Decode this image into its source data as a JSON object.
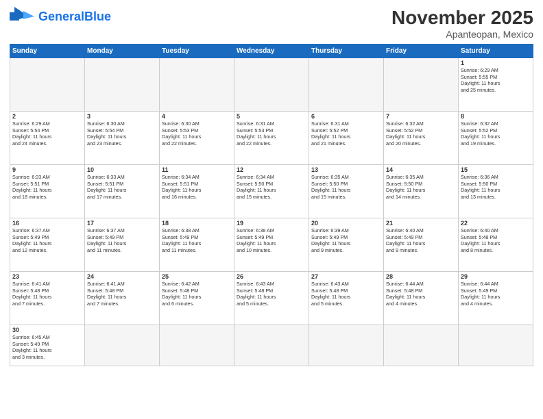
{
  "header": {
    "logo_general": "General",
    "logo_blue": "Blue",
    "title": "November 2025",
    "subtitle": "Apanteopan, Mexico"
  },
  "days_of_week": [
    "Sunday",
    "Monday",
    "Tuesday",
    "Wednesday",
    "Thursday",
    "Friday",
    "Saturday"
  ],
  "weeks": [
    {
      "days": [
        {
          "num": "",
          "info": ""
        },
        {
          "num": "",
          "info": ""
        },
        {
          "num": "",
          "info": ""
        },
        {
          "num": "",
          "info": ""
        },
        {
          "num": "",
          "info": ""
        },
        {
          "num": "",
          "info": ""
        },
        {
          "num": "1",
          "info": "Sunrise: 6:29 AM\nSunset: 5:55 PM\nDaylight: 11 hours\nand 25 minutes."
        }
      ]
    },
    {
      "days": [
        {
          "num": "2",
          "info": "Sunrise: 6:29 AM\nSunset: 5:54 PM\nDaylight: 11 hours\nand 24 minutes."
        },
        {
          "num": "3",
          "info": "Sunrise: 6:30 AM\nSunset: 5:54 PM\nDaylight: 11 hours\nand 23 minutes."
        },
        {
          "num": "4",
          "info": "Sunrise: 6:30 AM\nSunset: 5:53 PM\nDaylight: 11 hours\nand 22 minutes."
        },
        {
          "num": "5",
          "info": "Sunrise: 6:31 AM\nSunset: 5:53 PM\nDaylight: 11 hours\nand 22 minutes."
        },
        {
          "num": "6",
          "info": "Sunrise: 6:31 AM\nSunset: 5:52 PM\nDaylight: 11 hours\nand 21 minutes."
        },
        {
          "num": "7",
          "info": "Sunrise: 6:32 AM\nSunset: 5:52 PM\nDaylight: 11 hours\nand 20 minutes."
        },
        {
          "num": "8",
          "info": "Sunrise: 6:32 AM\nSunset: 5:52 PM\nDaylight: 11 hours\nand 19 minutes."
        }
      ]
    },
    {
      "days": [
        {
          "num": "9",
          "info": "Sunrise: 6:33 AM\nSunset: 5:51 PM\nDaylight: 11 hours\nand 18 minutes."
        },
        {
          "num": "10",
          "info": "Sunrise: 6:33 AM\nSunset: 5:51 PM\nDaylight: 11 hours\nand 17 minutes."
        },
        {
          "num": "11",
          "info": "Sunrise: 6:34 AM\nSunset: 5:51 PM\nDaylight: 11 hours\nand 16 minutes."
        },
        {
          "num": "12",
          "info": "Sunrise: 6:34 AM\nSunset: 5:50 PM\nDaylight: 11 hours\nand 15 minutes."
        },
        {
          "num": "13",
          "info": "Sunrise: 6:35 AM\nSunset: 5:50 PM\nDaylight: 11 hours\nand 15 minutes."
        },
        {
          "num": "14",
          "info": "Sunrise: 6:35 AM\nSunset: 5:50 PM\nDaylight: 11 hours\nand 14 minutes."
        },
        {
          "num": "15",
          "info": "Sunrise: 6:36 AM\nSunset: 5:50 PM\nDaylight: 11 hours\nand 13 minutes."
        }
      ]
    },
    {
      "days": [
        {
          "num": "16",
          "info": "Sunrise: 6:37 AM\nSunset: 5:49 PM\nDaylight: 11 hours\nand 12 minutes."
        },
        {
          "num": "17",
          "info": "Sunrise: 6:37 AM\nSunset: 5:49 PM\nDaylight: 11 hours\nand 11 minutes."
        },
        {
          "num": "18",
          "info": "Sunrise: 6:38 AM\nSunset: 5:49 PM\nDaylight: 11 hours\nand 11 minutes."
        },
        {
          "num": "19",
          "info": "Sunrise: 6:38 AM\nSunset: 5:49 PM\nDaylight: 11 hours\nand 10 minutes."
        },
        {
          "num": "20",
          "info": "Sunrise: 6:39 AM\nSunset: 5:49 PM\nDaylight: 11 hours\nand 9 minutes."
        },
        {
          "num": "21",
          "info": "Sunrise: 6:40 AM\nSunset: 5:49 PM\nDaylight: 11 hours\nand 9 minutes."
        },
        {
          "num": "22",
          "info": "Sunrise: 6:40 AM\nSunset: 5:48 PM\nDaylight: 11 hours\nand 8 minutes."
        }
      ]
    },
    {
      "days": [
        {
          "num": "23",
          "info": "Sunrise: 6:41 AM\nSunset: 5:48 PM\nDaylight: 11 hours\nand 7 minutes."
        },
        {
          "num": "24",
          "info": "Sunrise: 6:41 AM\nSunset: 5:48 PM\nDaylight: 11 hours\nand 7 minutes."
        },
        {
          "num": "25",
          "info": "Sunrise: 6:42 AM\nSunset: 5:48 PM\nDaylight: 11 hours\nand 6 minutes."
        },
        {
          "num": "26",
          "info": "Sunrise: 6:43 AM\nSunset: 5:48 PM\nDaylight: 11 hours\nand 5 minutes."
        },
        {
          "num": "27",
          "info": "Sunrise: 6:43 AM\nSunset: 5:48 PM\nDaylight: 11 hours\nand 5 minutes."
        },
        {
          "num": "28",
          "info": "Sunrise: 6:44 AM\nSunset: 5:48 PM\nDaylight: 11 hours\nand 4 minutes."
        },
        {
          "num": "29",
          "info": "Sunrise: 6:44 AM\nSunset: 5:49 PM\nDaylight: 11 hours\nand 4 minutes."
        }
      ]
    },
    {
      "days": [
        {
          "num": "30",
          "info": "Sunrise: 6:45 AM\nSunset: 5:49 PM\nDaylight: 11 hours\nand 3 minutes."
        },
        {
          "num": "",
          "info": ""
        },
        {
          "num": "",
          "info": ""
        },
        {
          "num": "",
          "info": ""
        },
        {
          "num": "",
          "info": ""
        },
        {
          "num": "",
          "info": ""
        },
        {
          "num": "",
          "info": ""
        }
      ]
    }
  ]
}
